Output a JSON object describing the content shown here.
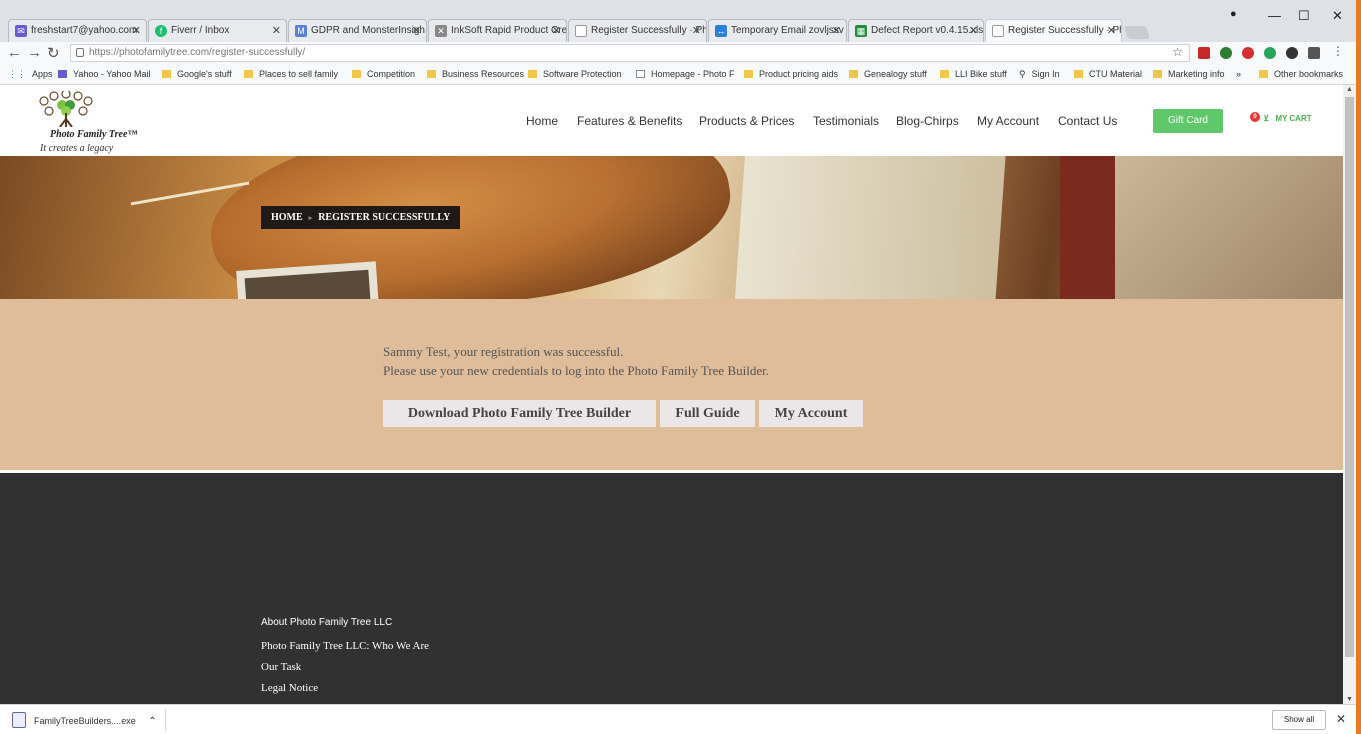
{
  "browser": {
    "tabs": [
      {
        "title": "freshstart7@yahoo.com",
        "icon": "mail-icon",
        "color": "#6a5acd"
      },
      {
        "title": "Fiverr / Inbox",
        "icon": "fiverr-icon",
        "color": "#1dbf73"
      },
      {
        "title": "GDPR and MonsterInsigh",
        "icon": "monsterinsights-icon",
        "color": "#5b7fd6"
      },
      {
        "title": "InkSoft Rapid Product Cre",
        "icon": "inksoft-icon",
        "color": "#888888"
      },
      {
        "title": "Register Successfully · Ph",
        "icon": "page-icon",
        "color": "#999999"
      },
      {
        "title": "Temporary Email zovljssv",
        "icon": "tempmail-icon",
        "color": "#2b7fd6"
      },
      {
        "title": "Defect Report v0.4.15.xlsx",
        "icon": "sheets-icon",
        "color": "#1e8e3e"
      },
      {
        "title": "Register Successfully · Ph",
        "icon": "page-icon",
        "color": "#999999"
      }
    ],
    "url": "https://photofamilytree.com/register-successfully/",
    "window_controls": {
      "minimize": "—",
      "maximize": "☐",
      "close": "✕"
    },
    "bookmarks": [
      "Apps",
      "Yahoo - Yahoo Mail",
      "Google's stuff",
      "Places to sell family",
      "Competition",
      "Business Resources",
      "Software Protection",
      "Homepage - Photo F",
      "Product pricing aids",
      "Genealogy stuff",
      "LLI Bike stuff",
      "Sign In",
      "CTU Material",
      "Marketing info",
      "»",
      "Other bookmarks"
    ]
  },
  "site": {
    "logo": {
      "name": "Photo Family Tree™",
      "tagline": "It creates a legacy"
    },
    "nav": [
      "Home",
      "Features & Benefits",
      "Products & Prices",
      "Testimonials",
      "Blog-Chirps",
      "My Account",
      "Contact Us"
    ],
    "gift_card": "Gift Card",
    "cart": {
      "label": "MY CART",
      "count": "0"
    },
    "breadcrumb": {
      "home": "HOME",
      "sep": "▸",
      "current": "REGISTER SUCCESSFULLY"
    },
    "message": {
      "line1": "Sammy Test, your registration was successful.",
      "line2": "Please use your new credentials to log into the Photo Family Tree Builder."
    },
    "buttons": [
      "Download Photo Family Tree Builder",
      "Full Guide",
      "My Account"
    ],
    "footer": {
      "heading": "About Photo Family Tree LLC",
      "links": [
        "Photo Family Tree LLC: Who We Are",
        "Our Task",
        "Legal Notice"
      ]
    }
  },
  "downloads": {
    "file": "FamilyTreeBuilders....exe",
    "show_all": "Show all"
  }
}
